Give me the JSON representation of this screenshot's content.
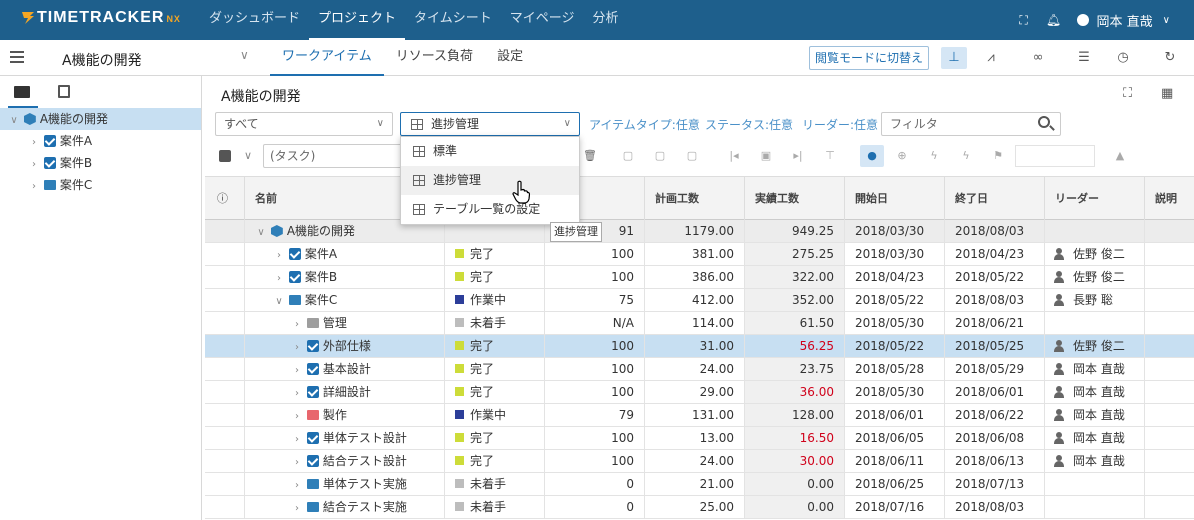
{
  "app": {
    "logo": "TIMETRACKER",
    "logo_suffix": "NX"
  },
  "nav": {
    "items": [
      "ダッシュボード",
      "プロジェクト",
      "タイムシート",
      "マイページ",
      "分析"
    ],
    "active": 1
  },
  "user": {
    "name": "岡本 直哉"
  },
  "project": {
    "name": "A機能の開発"
  },
  "tabs": [
    "ワークアイテム",
    "リソース負荷",
    "設定"
  ],
  "view_mode_button": "閲覧モードに切替え",
  "tree": [
    {
      "label": "A機能の開発",
      "level": 0,
      "icon": "cube-icon",
      "selected": true
    },
    {
      "label": "案件A",
      "level": 1,
      "icon": "checkbox-icon"
    },
    {
      "label": "案件B",
      "level": 1,
      "icon": "checkbox-icon"
    },
    {
      "label": "案件C",
      "level": 1,
      "icon": "folder-icon"
    }
  ],
  "main": {
    "title": "A機能の開発"
  },
  "filters": {
    "scope": "すべて",
    "view": "進捗管理",
    "item_type": "アイテムタイプ:任意",
    "status": "ステータス:任意",
    "leader": "リーダー:任意",
    "filter_placeholder": "フィルタ"
  },
  "task_input": {
    "placeholder": "(タスク)"
  },
  "view_menu": {
    "items": [
      "標準",
      "進捗管理",
      "テーブル一覧の設定"
    ],
    "hover": 1,
    "tooltip": "進捗管理"
  },
  "table": {
    "headers": [
      "名前",
      "",
      "捗",
      "計画工数",
      "実績工数",
      "開始日",
      "終了日",
      "リーダー",
      "説明"
    ],
    "rows": [
      {
        "name": "A機能の開発",
        "level": 0,
        "icon": "cube",
        "status": "",
        "progress": "91",
        "plan": "1179.00",
        "actual": "949.25",
        "start": "2018/03/30",
        "end": "2018/08/03",
        "leader": ""
      },
      {
        "name": "案件A",
        "level": 1,
        "icon": "check",
        "status": "完了",
        "color": "#cddc39",
        "progress": "100",
        "plan": "381.00",
        "actual": "275.25",
        "start": "2018/03/30",
        "end": "2018/04/23",
        "leader": "佐野 俊二"
      },
      {
        "name": "案件B",
        "level": 1,
        "icon": "check",
        "status": "完了",
        "color": "#cddc39",
        "progress": "100",
        "plan": "386.00",
        "actual": "322.00",
        "start": "2018/04/23",
        "end": "2018/05/22",
        "leader": "佐野 俊二"
      },
      {
        "name": "案件C",
        "level": 1,
        "icon": "folder",
        "status": "作業中",
        "color": "#2c3e99",
        "progress": "75",
        "plan": "412.00",
        "actual": "352.00",
        "start": "2018/05/22",
        "end": "2018/08/03",
        "leader": "長野 聡",
        "open": true
      },
      {
        "name": "管理",
        "level": 2,
        "icon": "folderg",
        "status": "未着手",
        "color": "#bdbdbd",
        "progress": "N/A",
        "plan": "114.00",
        "actual": "61.50",
        "start": "2018/05/30",
        "end": "2018/06/21",
        "leader": ""
      },
      {
        "name": "外部仕様",
        "level": 2,
        "icon": "check",
        "status": "完了",
        "color": "#cddc39",
        "progress": "100",
        "plan": "31.00",
        "actual": "56.25",
        "over": true,
        "start": "2018/05/22",
        "end": "2018/05/25",
        "leader": "佐野 俊二",
        "hl": true
      },
      {
        "name": "基本設計",
        "level": 2,
        "icon": "check",
        "status": "完了",
        "color": "#cddc39",
        "progress": "100",
        "plan": "24.00",
        "actual": "23.75",
        "start": "2018/05/28",
        "end": "2018/05/29",
        "leader": "岡本 直哉"
      },
      {
        "name": "詳細設計",
        "level": 2,
        "icon": "check",
        "status": "完了",
        "color": "#cddc39",
        "progress": "100",
        "plan": "29.00",
        "actual": "36.00",
        "over": true,
        "start": "2018/05/30",
        "end": "2018/06/01",
        "leader": "岡本 直哉"
      },
      {
        "name": "製作",
        "level": 2,
        "icon": "folderr",
        "status": "作業中",
        "color": "#2c3e99",
        "progress": "79",
        "plan": "131.00",
        "actual": "128.00",
        "start": "2018/06/01",
        "end": "2018/06/22",
        "leader": "岡本 直哉"
      },
      {
        "name": "単体テスト設計",
        "level": 2,
        "icon": "check",
        "status": "完了",
        "color": "#cddc39",
        "progress": "100",
        "plan": "13.00",
        "actual": "16.50",
        "over": true,
        "start": "2018/06/05",
        "end": "2018/06/08",
        "leader": "岡本 直哉"
      },
      {
        "name": "結合テスト設計",
        "level": 2,
        "icon": "check",
        "status": "完了",
        "color": "#cddc39",
        "progress": "100",
        "plan": "24.00",
        "actual": "30.00",
        "over": true,
        "start": "2018/06/11",
        "end": "2018/06/13",
        "leader": "岡本 直哉"
      },
      {
        "name": "単体テスト実施",
        "level": 2,
        "icon": "folder",
        "status": "未着手",
        "color": "#bdbdbd",
        "progress": "0",
        "plan": "21.00",
        "actual": "0.00",
        "start": "2018/06/25",
        "end": "2018/07/13",
        "leader": ""
      },
      {
        "name": "結合テスト実施",
        "level": 2,
        "icon": "folder",
        "status": "未着手",
        "color": "#bdbdbd",
        "progress": "0",
        "plan": "25.00",
        "actual": "0.00",
        "start": "2018/07/16",
        "end": "2018/08/03",
        "leader": ""
      }
    ]
  }
}
